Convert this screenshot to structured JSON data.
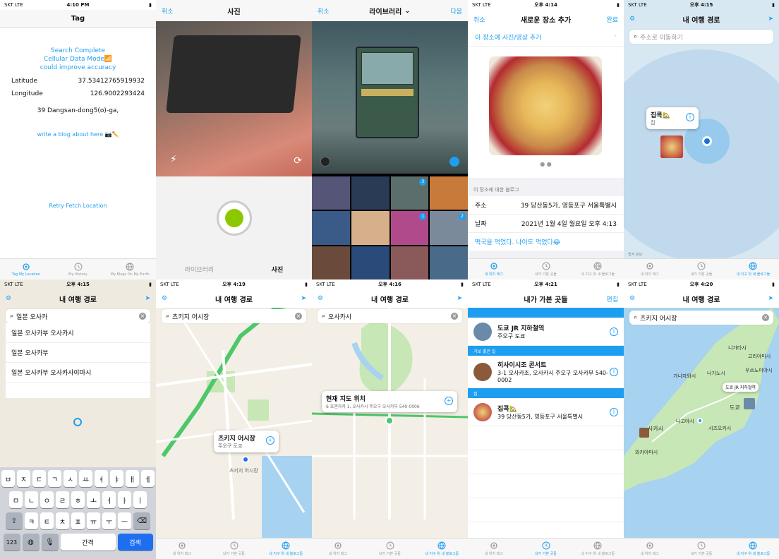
{
  "s1": {
    "status": {
      "carrier": "SKT  LTE",
      "time": "4:10 PM"
    },
    "title": "Tag",
    "search_complete": "Search Complete",
    "cellular": "Cellular Data Mode📶",
    "accuracy": "could improve accuracy",
    "lat_label": "Latitude",
    "lat_value": "37.53412765919932",
    "lon_label": "Longitude",
    "lon_value": "126.9002293424",
    "address": "39 Dangsan-dong5(o)-ga,",
    "blog": "write a blog about here 📷✏️",
    "retry": "Retry Fetch Location",
    "tabs": [
      "Tag My Location",
      "My History",
      "My Blogs On My Earth"
    ]
  },
  "s2": {
    "cancel": "취소",
    "title": "사진",
    "library": "라이브러리",
    "photo": "사진"
  },
  "s3": {
    "cancel": "취소",
    "title": "라이브러리",
    "done": "다음",
    "badges": [
      "3",
      "1",
      "2"
    ]
  },
  "s4": {
    "status": {
      "carrier": "SKT  LTE",
      "time": "오후 4:14"
    },
    "cancel": "취소",
    "title": "새로운 장소 추가",
    "done": "완료",
    "add_photo": "이 장소에 사진/영상 추가",
    "blog_header": "이 장소에 대한 블로그",
    "addr_label": "주소",
    "addr_value": "39 당산동5가, 영등포구 서울특별시",
    "date_label": "날짜",
    "date_value": "2021년 1월 4일 월요일 오후 4:13",
    "note": "떡국을 먹었다. 나이도 먹었다😂",
    "tabs": [
      "내 위치 태그",
      "내가 가본 곳들",
      "내 지구 위 내 블로그들"
    ]
  },
  "s5": {
    "status": {
      "carrier": "SKT  LTE",
      "time": "오후 4:15"
    },
    "title": "내 여행 경로",
    "placeholder": "주소로 이동하기",
    "callout_title": "집콕🏡",
    "callout_sub": "집",
    "legal": "법적 정보",
    "tabs": [
      "내 위치 태그",
      "내가 가본 곳들",
      "내 지구 위 내 블로그들"
    ]
  },
  "s6": {
    "status": {
      "carrier": "SKT  LTE",
      "time": "오후 4:15"
    },
    "title": "내 여행 경로",
    "query": "일본 오사카",
    "suggestions": [
      "일본 오사카부 오사카시",
      "일본 오사카부",
      "일본 오사카부 오사카사야마시"
    ],
    "keys": {
      "r1": [
        "ㅂ",
        "ㅈ",
        "ㄷ",
        "ㄱ",
        "ㅅ",
        "ㅛ",
        "ㅕ",
        "ㅑ",
        "ㅐ",
        "ㅔ"
      ],
      "r2": [
        "ㅁ",
        "ㄴ",
        "ㅇ",
        "ㄹ",
        "ㅎ",
        "ㅗ",
        "ㅓ",
        "ㅏ",
        "ㅣ"
      ],
      "r3": [
        "ㅋ",
        "ㅌ",
        "ㅊ",
        "ㅍ",
        "ㅠ",
        "ㅜ",
        "ㅡ"
      ],
      "num": "123",
      "space": "간격",
      "search": "검색"
    }
  },
  "s7": {
    "status": {
      "carrier": "SKT  LTE",
      "time": "오후 4:19"
    },
    "title": "내 여행 경로",
    "query": "츠키지 어시장",
    "callout_title": "츠키지 어시장",
    "callout_sub": "주오구 도쿄",
    "pin_label": "츠키지 어시장",
    "tabs": [
      "내 위치 태그",
      "내가 가본 곳들",
      "내 지구 위 내 블로그들"
    ]
  },
  "s8": {
    "status": {
      "carrier": "SKT  LTE",
      "time": "오후 4:16"
    },
    "title": "내 여행 경로",
    "query": "오사카시",
    "callout_title": "현재 지도 위치",
    "callout_sub": "6 호엔자카 1, 오사카시 주오구 오사카부 540-0006",
    "tabs": [
      "내 위치 태그",
      "내가 가본 곳들",
      "내 지구 위 내 블로그들"
    ]
  },
  "s9": {
    "status": {
      "carrier": "SKT  LTE",
      "time": "오후 4:21"
    },
    "title": "내가 가본 곳들",
    "edit": "편집",
    "sections": [
      {
        "header": "",
        "title": "도쿄 JR 지하철역",
        "sub": "주오구 도쿄"
      },
      {
        "header": "가보 좋은 일",
        "title": "히사이시조 콘서트",
        "sub": "3-1 오사카조, 오사카시 주오구 오사카부 540-0002"
      },
      {
        "header": "집",
        "title": "집콕🏡",
        "sub": "39 당산동5가, 영등포구 서울특별시"
      }
    ],
    "tabs": [
      "내 위치 태그",
      "내가 가본 곳들",
      "내 지구 위 내 블로그들"
    ]
  },
  "s10": {
    "status": {
      "carrier": "SKT  LTE",
      "time": "오후 4:20"
    },
    "title": "내 여행 경로",
    "query": "츠키지 어시장",
    "callout": "도쿄 JR 지하철역",
    "cities": [
      "니가타시",
      "고리야마시",
      "나가노시",
      "우쓰노미야시",
      "도쿄",
      "시즈오카시",
      "나고야시",
      "사카시",
      "와카야마시",
      "가나자와시"
    ],
    "tabs": [
      "내 위치 태그",
      "내가 가본 곳들",
      "내 지구 위 내 블로그들"
    ]
  },
  "colors": {
    "accent": "#1e9ef0",
    "map_land": "#f3efe6",
    "water": "#a7d3f0",
    "park": "#c7e7b6"
  }
}
